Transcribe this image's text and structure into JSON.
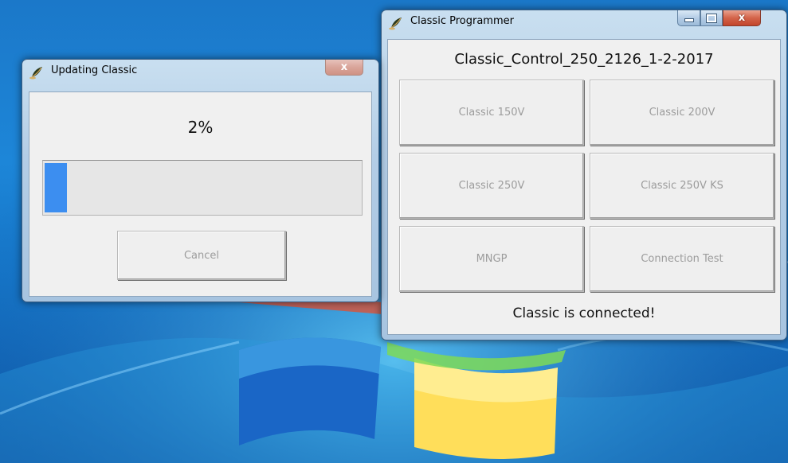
{
  "updating_window": {
    "title": "Updating Classic",
    "percent_label": "2%",
    "progress_fraction": 0.02,
    "cancel_label": "Cancel",
    "close_glyph": "x"
  },
  "programmer_window": {
    "title": "Classic Programmer",
    "version_label": "Classic_Control_250_2126_1-2-2017",
    "buttons": [
      {
        "label": "Classic 150V"
      },
      {
        "label": "Classic 200V"
      },
      {
        "label": "Classic 250V"
      },
      {
        "label": "Classic 250V KS"
      },
      {
        "label": "MNGP"
      },
      {
        "label": "Connection Test"
      }
    ],
    "status_label": "Classic is connected!",
    "minimize_glyph": "–",
    "maximize_glyph": "□",
    "close_glyph": "x"
  },
  "colors": {
    "progress_fill": "#3c8ef0",
    "desktop": "#1b78c9",
    "close_button": "#c2452c"
  },
  "icons": {
    "app_icon": "leaf-icon"
  }
}
